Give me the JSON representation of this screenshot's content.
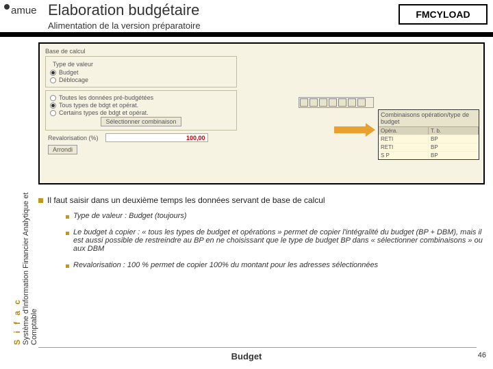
{
  "header": {
    "logo": "amue",
    "title": "Elaboration budgétaire",
    "subtitle": "Alimentation de la version préparatoire",
    "tcode": "FMCYLOAD"
  },
  "sidebar": {
    "sifac": "S i f a c",
    "full1": "Système d'Information Financier Analytique et",
    "full2": "Comptable"
  },
  "sap": {
    "base_label": "Base de calcul",
    "type_label": "Type de valeur",
    "r_budget": "Budget",
    "r_debloc": "Déblocage",
    "r_tous": "Toutes les données pré-budgétées",
    "r_tous_types": "Tous types de bdgt et opérat.",
    "r_certains": "Certains types de bdgt et opérat.",
    "btn_select": "Sélectionner combinaison",
    "reval_label": "Revalorisation (%)",
    "reval_value": "100,00",
    "arrondi": "Arrondi"
  },
  "popup": {
    "title": "Combinaisons opération/type de budget",
    "col1": "Opéra.",
    "col2": "T. b.",
    "rows": [
      {
        "c1": "RETI",
        "c2": "BP"
      },
      {
        "c1": "RETI",
        "c2": "BP"
      },
      {
        "c1": "S P",
        "c2": "BP"
      }
    ]
  },
  "bullets": {
    "main": "Il faut saisir dans un deuxième temps les données servant de base de calcul",
    "s1": "Type de valeur : Budget (toujours)",
    "s2": "Le budget à copier : « tous les types de budget et opérations » permet de copier l'intégralité du budget (BP + DBM), mais il est aussi possible de restreindre au BP en ne choisissant que le type de budget BP dans « sélectionner combinaisons » ou aux DBM",
    "s3": "Revalorisation : 100 % permet de copier 100% du montant pour les adresses sélectionnées"
  },
  "footer": {
    "title": "Budget",
    "page": "46"
  }
}
